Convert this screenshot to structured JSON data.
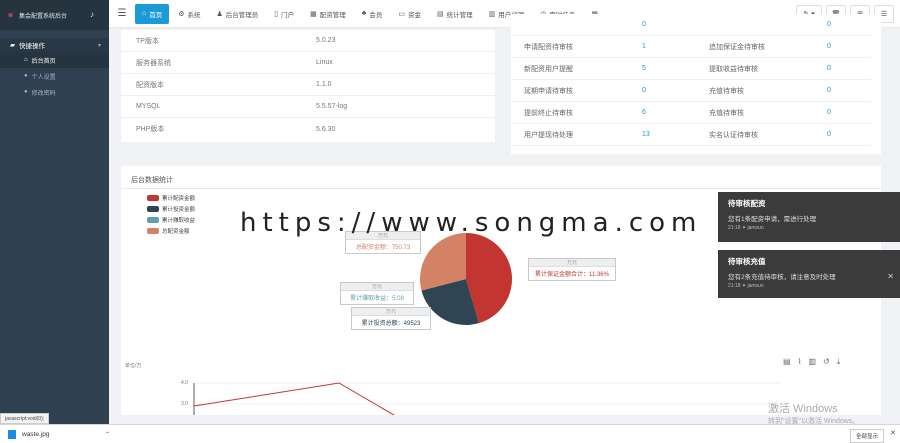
{
  "sidebar": {
    "brand": "集会配置系统后台",
    "logo": "≋",
    "group_label": "快捷操作",
    "items": [
      {
        "label": "后台首页",
        "active": true
      },
      {
        "label": "个人设置",
        "active": false
      },
      {
        "label": "修改密码",
        "active": false
      }
    ]
  },
  "topbar": {
    "tabs": [
      {
        "label": "首页",
        "icon": "home-icon",
        "active": true
      },
      {
        "label": "系统",
        "icon": "gear-icon",
        "active": false
      },
      {
        "label": "后台管理员",
        "icon": "user-icon",
        "active": false
      },
      {
        "label": "门户",
        "icon": "",
        "active": false
      },
      {
        "label": "配资管理",
        "icon": "calc-icon",
        "active": false
      },
      {
        "label": "会员",
        "icon": "group-icon",
        "active": false
      },
      {
        "label": "资金",
        "icon": "money-icon",
        "active": false
      },
      {
        "label": "统计管理",
        "icon": "chart-icon",
        "active": false
      },
      {
        "label": "用户代理",
        "icon": "agent-icon",
        "active": false
      },
      {
        "label": "定时任务",
        "icon": "clock-icon",
        "active": false
      }
    ],
    "right_buttons": [
      "✎ ▾",
      "🗑",
      "⊞",
      "☰"
    ]
  },
  "system_info": [
    {
      "key": "TP版本",
      "value": "5.0.23"
    },
    {
      "key": "服务器系统",
      "value": "Linux"
    },
    {
      "key": "配资版本",
      "value": "1.1.0"
    },
    {
      "key": "MYSQL",
      "value": "5.5.57-log"
    },
    {
      "key": "PHP版本",
      "value": "5.6.30"
    }
  ],
  "pending": {
    "left": [
      {
        "key": "",
        "value": "0"
      },
      {
        "key": "申请配资待审核",
        "value": "1"
      },
      {
        "key": "新配资用户提醒",
        "value": "5"
      },
      {
        "key": "延期申请待审核",
        "value": "0"
      },
      {
        "key": "提前终止待审核",
        "value": "6"
      },
      {
        "key": "用户提现待处理",
        "value": "13"
      }
    ],
    "right": [
      {
        "key": "",
        "value": "0"
      },
      {
        "key": "追加保证金待审核",
        "value": "0"
      },
      {
        "key": "提取收益待审核",
        "value": "0"
      },
      {
        "key": "充值待审核",
        "value": "0"
      },
      {
        "key": "充值待审核",
        "value": "0"
      },
      {
        "key": "实名认证待审核",
        "value": "0"
      }
    ]
  },
  "chart_panel": {
    "title": "后台数据统计"
  },
  "chart_data": {
    "type": "pie",
    "title": "",
    "series": [
      {
        "name": "累计配资金额",
        "value": 113.69,
        "color": "#c23531",
        "label": "累计保证金额合计：11.36%"
      },
      {
        "name": "累计投资金额",
        "value": 49523,
        "color": "#2f4554",
        "label": "累计投资总额：49523"
      },
      {
        "name": "累计赚取收益",
        "value": 5.08,
        "color": "#61a0a8",
        "label": "累计赚取收益：5.08"
      },
      {
        "name": "总配资金额",
        "value": 750.73,
        "color": "#d48265",
        "label": "总配资金额：750.73"
      }
    ],
    "legend_position": "top-left",
    "tooltip_unit": "万元"
  },
  "line_panel": {
    "ylabel": "单位/万",
    "y_ticks": [
      "4.0",
      "3.0"
    ],
    "toolbar": [
      "▤",
      "⌇",
      "▥",
      "↺",
      "⤓"
    ]
  },
  "watermark": "https://www.songma.com",
  "toasts": [
    {
      "title": "待审核配资",
      "message": "您有1条配资申请，需进行处理",
      "sub": "21:18 ✦ jamsun"
    },
    {
      "title": "待审核充值",
      "message": "您有2条充值待审核，请注意及时处理",
      "sub": "21:18 ✦ jamsun"
    }
  ],
  "windows_activation": {
    "line1": "激活 Windows",
    "line2": "转到\"设置\"以激活 Windows。"
  },
  "status_url": "javascript:void(0);",
  "downloads": {
    "file": "waste.jpg",
    "show_all": "全部显示"
  }
}
